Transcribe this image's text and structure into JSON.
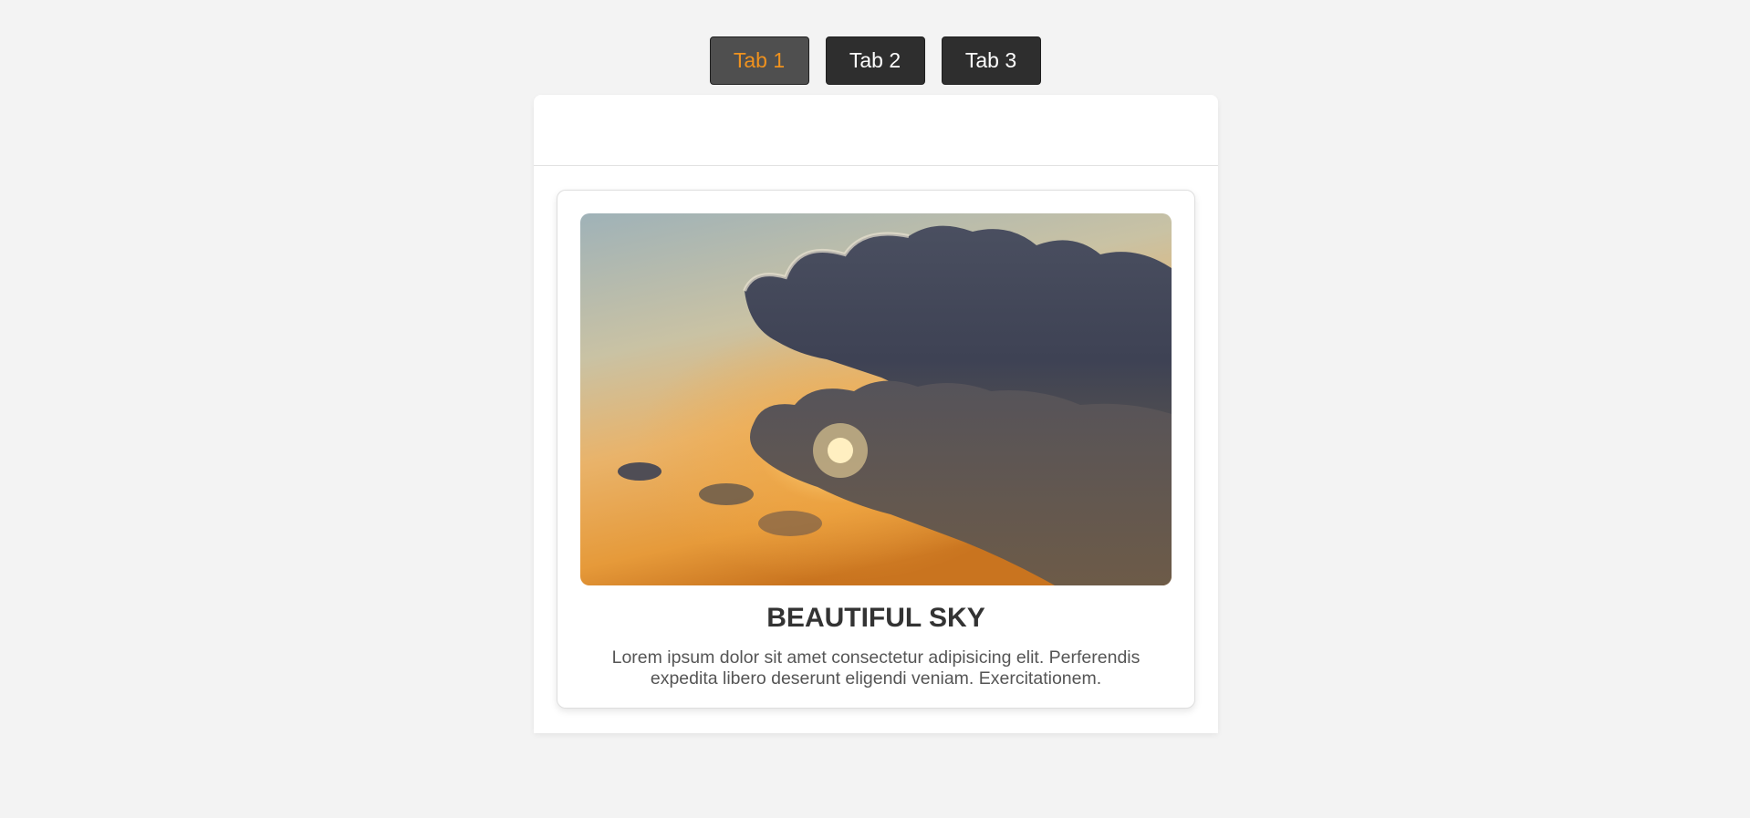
{
  "tabs": [
    {
      "label": "Tab 1",
      "active": true
    },
    {
      "label": "Tab 2",
      "active": false
    },
    {
      "label": "Tab 3",
      "active": false
    }
  ],
  "card": {
    "title": "BEAUTIFUL SKY",
    "text": "Lorem ipsum dolor sit amet consectetur adipisicing elit. Perferendis expedita libero deserunt eligendi veniam. Exercitationem.",
    "image": "sunset-sky-with-clouds"
  },
  "colors": {
    "background": "#f3f3f3",
    "tab_bg": "#2e2e2e",
    "tab_active_bg": "#4f4f4f",
    "tab_active_text": "#f0921e"
  }
}
